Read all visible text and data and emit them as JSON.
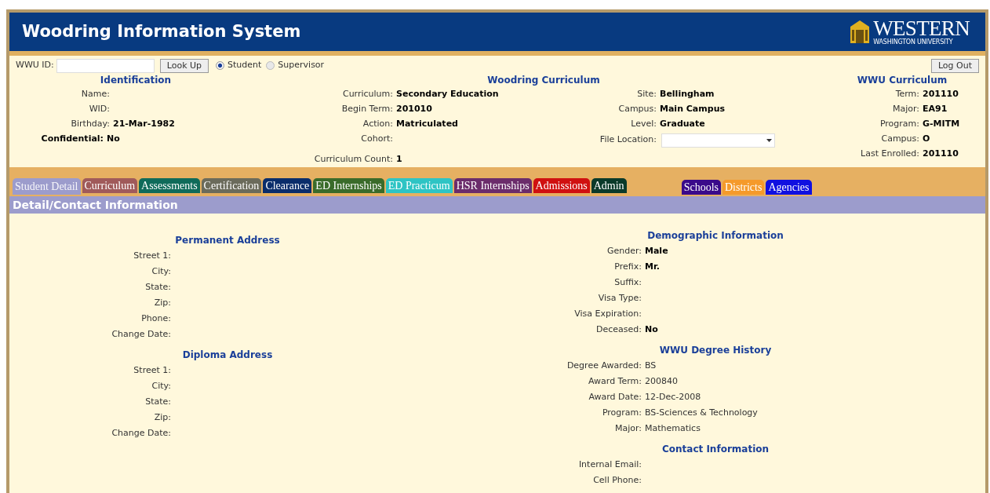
{
  "header": {
    "title": "Woodring Information System",
    "logo": {
      "name": "WESTERN",
      "subtitle": "WASHINGTON UNIVERSITY"
    }
  },
  "lookup": {
    "label": "WWU ID:",
    "button": "Look Up",
    "radios": [
      {
        "label": "Student",
        "selected": true
      },
      {
        "label": "Supervisor",
        "selected": false
      }
    ],
    "logout": "Log Out"
  },
  "identification": {
    "heading": "Identification",
    "fields": [
      {
        "label": "Name:",
        "bold": false
      },
      {
        "label": "WID:",
        "bold": false
      },
      {
        "label": "Birthday:",
        "value": "21-Mar-1982",
        "bold": false
      },
      {
        "label": "Confidential:",
        "value": "No",
        "bold": true
      }
    ]
  },
  "woodring_curriculum": {
    "heading": "Woodring Curriculum",
    "left": [
      {
        "label": "Curriculum:",
        "value": "Secondary Education"
      },
      {
        "label": "Begin Term:",
        "value": "201010"
      },
      {
        "label": "Action:",
        "value": "Matriculated"
      },
      {
        "label": "Cohort:"
      }
    ],
    "right": [
      {
        "label": "Site:",
        "value": "Bellingham",
        "kind": "text"
      },
      {
        "label": "Campus:",
        "value": "Main Campus",
        "kind": "text"
      },
      {
        "label": "Level:",
        "value": "Graduate",
        "kind": "text"
      },
      {
        "label": "File Location:",
        "kind": "select"
      }
    ],
    "count": {
      "label": "Curriculum Count:",
      "value": "1"
    }
  },
  "wwu_curriculum": {
    "heading": "WWU Curriculum",
    "fields": [
      {
        "label": "Term:",
        "value": "201110"
      },
      {
        "label": "Major:",
        "value": "EA91"
      },
      {
        "label": "Program:",
        "value": "G-MITM"
      },
      {
        "label": "Campus:",
        "value": "O"
      },
      {
        "label": "Last Enrolled:",
        "value": "201110"
      }
    ]
  },
  "tabs": [
    {
      "label": "Student Detail",
      "color": "#9c9ccc",
      "selected": true
    },
    {
      "label": "Curriculum",
      "color": "#a05a5a",
      "selected": false
    },
    {
      "label": "Assessments",
      "color": "#0f6b5a",
      "selected": false
    },
    {
      "label": "Certification",
      "color": "#6b6b5b",
      "selected": false
    },
    {
      "label": "Clearance",
      "color": "#0a2d6b",
      "selected": false
    },
    {
      "label": "ED Internships",
      "color": "#3a6b2a",
      "selected": false
    },
    {
      "label": "ED Practicum",
      "color": "#2ec4c4",
      "selected": false
    },
    {
      "label": "HSR Internships",
      "color": "#6b2c6b",
      "selected": false
    },
    {
      "label": "Admissions",
      "color": "#d01010",
      "selected": false
    },
    {
      "label": "Admin",
      "color": "#0a3a2a",
      "selected": false
    }
  ],
  "directory_tabs": [
    {
      "label": "Schools",
      "color": "#3a0a8a",
      "selected": false
    },
    {
      "label": "Districts",
      "color": "#f59a2a",
      "selected": false
    },
    {
      "label": "Agencies",
      "color": "#1010e0",
      "selected": false
    }
  ],
  "section_title": "Detail/Contact Information",
  "left_sections": [
    {
      "heading": "Permanent Address",
      "fields": [
        {
          "label": "Street 1:"
        },
        {
          "label": "City:"
        },
        {
          "label": "State:"
        },
        {
          "label": "Zip:"
        },
        {
          "label": "Phone:"
        },
        {
          "label": "Change Date:"
        }
      ]
    },
    {
      "heading": "Diploma Address",
      "fields": [
        {
          "label": "Street 1:"
        },
        {
          "label": "City:"
        },
        {
          "label": "State:"
        },
        {
          "label": "Zip:"
        },
        {
          "label": "Change Date:"
        }
      ]
    }
  ],
  "right_sections": [
    {
      "heading": "Demographic Information",
      "bold_values": true,
      "fields": [
        {
          "label": "Gender:",
          "value": "Male"
        },
        {
          "label": "Prefix:",
          "value": "Mr."
        },
        {
          "label": "Suffix:"
        },
        {
          "label": "Visa Type:"
        },
        {
          "label": "Visa Expiration:"
        },
        {
          "label": "Deceased:",
          "value": "No"
        }
      ]
    },
    {
      "heading": "WWU Degree History",
      "bold_values": false,
      "fields": [
        {
          "label": "Degree Awarded:",
          "value": "BS"
        },
        {
          "label": "Award Term:",
          "value": "200840"
        },
        {
          "label": "Award Date:",
          "value": "12-Dec-2008"
        },
        {
          "label": "Program:",
          "value": "BS-Sciences & Technology"
        },
        {
          "label": "Major:",
          "value": "Mathematics"
        }
      ]
    },
    {
      "heading": "Contact Information",
      "fields": [
        {
          "label": "Internal Email:"
        },
        {
          "label": "Cell Phone:"
        }
      ]
    }
  ]
}
